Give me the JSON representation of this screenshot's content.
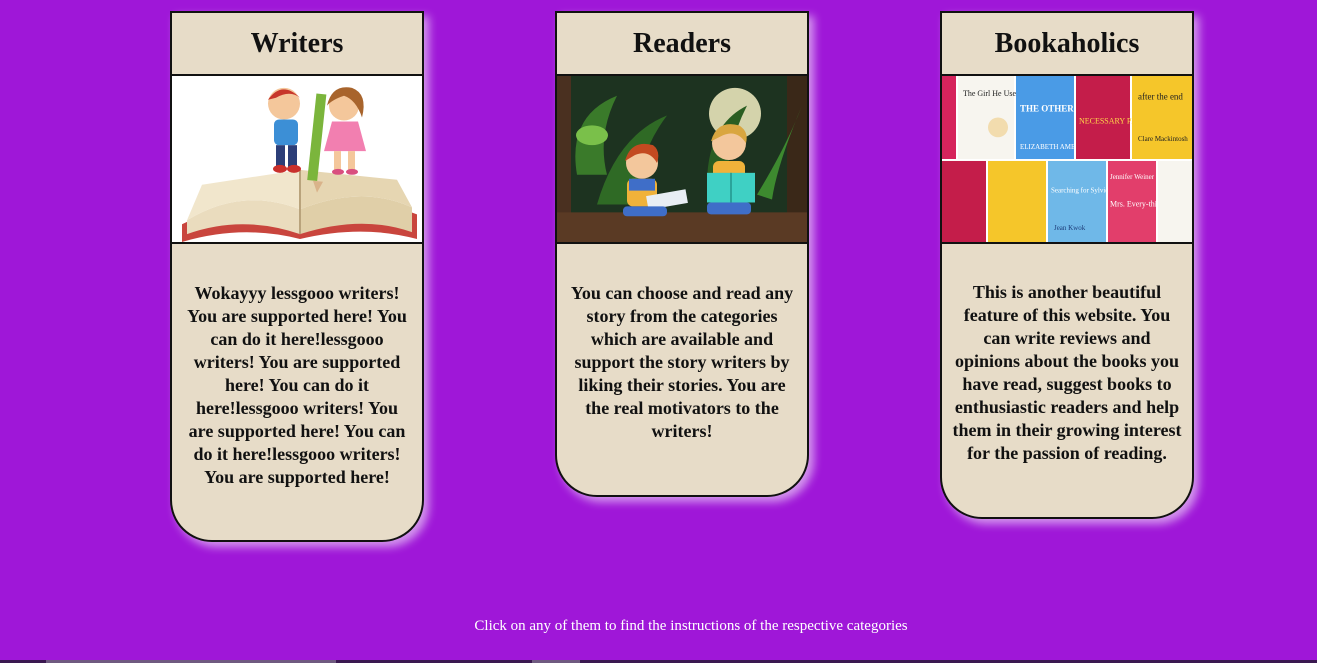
{
  "cards": [
    {
      "id": "writers",
      "title": "Writers",
      "image": "children-with-pencil-on-open-book",
      "text": "Wokayyy lessgooo writers! You are supported here! You can do it here!lessgooo writers! You are supported here! You can do it here!lessgooo writers! You are supported here! You can do it here!lessgooo writers! You are supported here!"
    },
    {
      "id": "readers",
      "title": "Readers",
      "image": "children-reading-in-forest",
      "text": "You can choose and read any story from the categories which are available and support the story writers by liking their stories. You are the real motivators to the writers!"
    },
    {
      "id": "bookaholics",
      "title": "Bookaholics",
      "image": "book-covers-collage",
      "covers": {
        "girl_used_to_know": "The Girl He Used to Know",
        "others_gold": "THE OTHER'S GOLD",
        "elizabeth_ames": "ELIZABETH AMES",
        "necessary_people": "NECESSARY PEOPLE",
        "after_the_end": "after the end",
        "clare_mackintosh": "Clare Mackintosh",
        "searching_for_sylvie_lee": "Searching for Sylvie Lee",
        "jean_kwok": "Jean Kwok",
        "jennifer_weiner": "Jennifer Weiner",
        "mrs_everything": "Mrs. Every-thing"
      },
      "text": "This is another beautiful feature of this website. You can write reviews and opinions about the books you have read, suggest books to enthusiastic readers and help them in their growing interest for the passion of reading."
    }
  ],
  "footer": {
    "note": "Click on any of them to find the instructions of the respective categories"
  },
  "colors": {
    "page_background": "#9f17d8",
    "card_background": "#e7dcc8",
    "border": "#111111",
    "footer_text": "#ffffff"
  }
}
